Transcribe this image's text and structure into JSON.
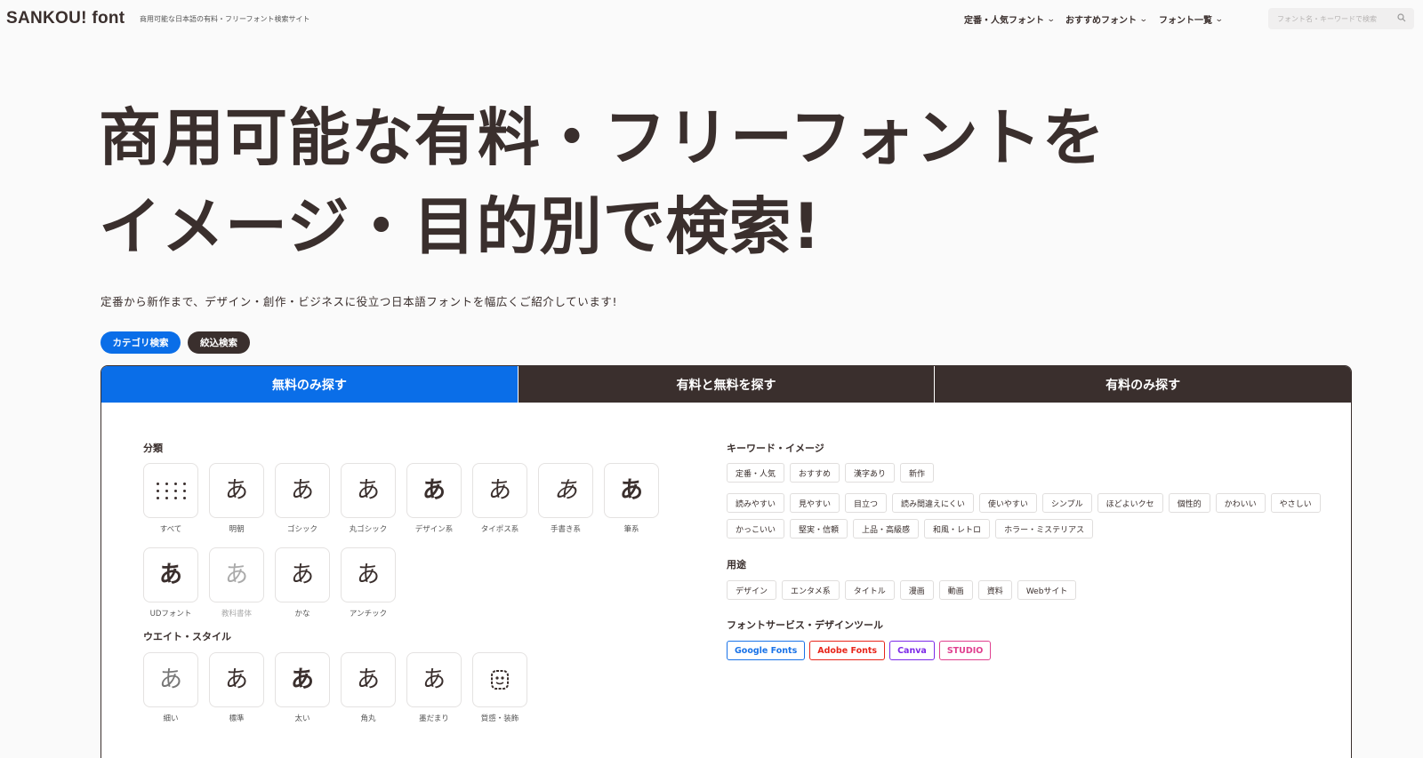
{
  "header": {
    "logo": "SANKOU! font",
    "tagline": "商用可能な日本語の有料・フリーフォント検索サイト",
    "nav": [
      {
        "label": "定番・人気フォント"
      },
      {
        "label": "おすすめフォント"
      },
      {
        "label": "フォント一覧"
      }
    ],
    "search_placeholder": "フォント名・キーワードで検索"
  },
  "hero": {
    "line1": "商用可能な有料・フリーフォントを",
    "line2": "イメージ・目的別で検索!",
    "subtitle": "定番から新作まで、デザイン・創作・ビジネスに役立つ日本語フォントを幅広くご紹介しています!"
  },
  "filters": {
    "category": "カテゴリ検索",
    "narrow": "絞込検索"
  },
  "tabs": [
    {
      "label": "無料のみ探す",
      "active": true
    },
    {
      "label": "有料と無料を探す",
      "active": false
    },
    {
      "label": "有料のみ探す",
      "active": false
    }
  ],
  "classification": {
    "title": "分類",
    "items": [
      {
        "label": "すべて",
        "glyph": ""
      },
      {
        "label": "明朝",
        "glyph": "あ"
      },
      {
        "label": "ゴシック",
        "glyph": "あ"
      },
      {
        "label": "丸ゴシック",
        "glyph": "あ"
      },
      {
        "label": "デザイン系",
        "glyph": "あ"
      },
      {
        "label": "タイポス系",
        "glyph": "あ"
      },
      {
        "label": "手書き系",
        "glyph": "あ"
      },
      {
        "label": "筆系",
        "glyph": "あ"
      },
      {
        "label": "UDフォント",
        "glyph": "あ"
      },
      {
        "label": "教科書体",
        "glyph": "あ"
      },
      {
        "label": "かな",
        "glyph": "あ"
      },
      {
        "label": "アンチック",
        "glyph": "あ"
      }
    ]
  },
  "weight": {
    "title": "ウエイト・スタイル",
    "items": [
      {
        "label": "細い",
        "glyph": "あ"
      },
      {
        "label": "標準",
        "glyph": "あ"
      },
      {
        "label": "太い",
        "glyph": "あ"
      },
      {
        "label": "角丸",
        "glyph": "あ"
      },
      {
        "label": "墨だまり",
        "glyph": "あ"
      },
      {
        "label": "質感・装飾",
        "glyph": ""
      }
    ]
  },
  "keywords": {
    "title": "キーワード・イメージ",
    "row1": [
      "定番・人気",
      "おすすめ",
      "漢字あり",
      "新作"
    ],
    "row2": [
      "読みやすい",
      "見やすい",
      "目立つ",
      "読み間違えにくい",
      "使いやすい",
      "シンプル",
      "ほどよいクセ",
      "個性的",
      "かわいい",
      "やさしい"
    ],
    "row3": [
      "かっこいい",
      "堅実・信頼",
      "上品・高級感",
      "和風・レトロ",
      "ホラー・ミステリアス"
    ]
  },
  "usage": {
    "title": "用途",
    "tags": [
      "デザイン",
      "エンタメ系",
      "タイトル",
      "漫画",
      "動画",
      "資料",
      "Webサイト"
    ]
  },
  "services": {
    "title": "フォントサービス・デザインツール",
    "items": [
      {
        "label": "Google Fonts",
        "color": "#1a73e8"
      },
      {
        "label": "Adobe Fonts",
        "color": "#e8261b"
      },
      {
        "label": "Canva",
        "color": "#7d2ae8"
      },
      {
        "label": "STUDIO",
        "color": "#e0408f"
      }
    ]
  },
  "colors": {
    "accent": "#0a6ee8",
    "dark": "#3a2f2d"
  }
}
